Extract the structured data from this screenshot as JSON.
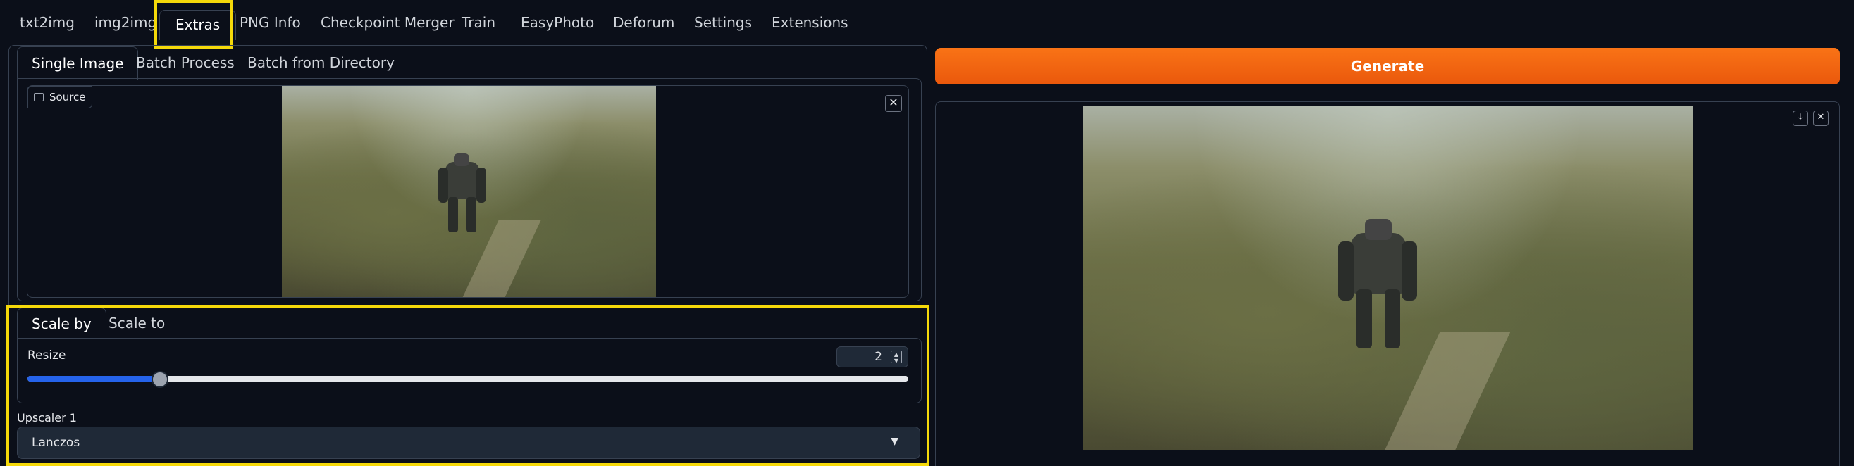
{
  "top_tabs": [
    "txt2img",
    "img2img",
    "Extras",
    "PNG Info",
    "Checkpoint Merger",
    "Train",
    "EasyPhoto",
    "Deforum",
    "Settings",
    "Extensions"
  ],
  "sub_tabs": [
    "Single Image",
    "Batch Process",
    "Batch from Directory"
  ],
  "source_label": "Source",
  "scale_tabs": [
    "Scale by",
    "Scale to"
  ],
  "resize": {
    "label": "Resize",
    "value": "2",
    "slider_fraction": 0.15
  },
  "upscaler": {
    "label": "Upscaler 1",
    "value": "Lanczos"
  },
  "generate_label": "Generate",
  "colors": {
    "accent": "#f97316",
    "highlight": "#f5d90a",
    "slider": "#2563eb"
  },
  "icons": [
    "image-icon",
    "close-icon",
    "download-icon",
    "chevron-down-icon",
    "spinner-arrows-icon"
  ]
}
